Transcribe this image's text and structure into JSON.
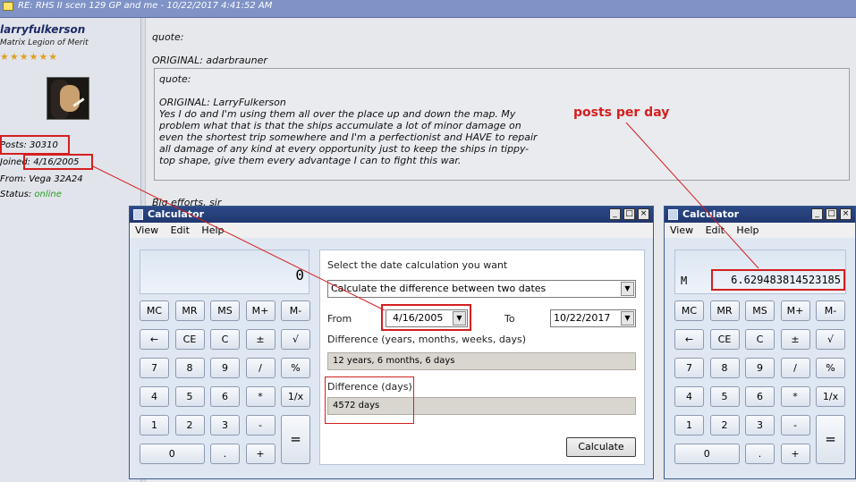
{
  "forum": {
    "post_title": "RE: RHS II scen 129 GP and me - 10/22/2017 4:41:52 AM",
    "username": "larryfulkerson",
    "rank": "Matrix Legion of Merit",
    "stars": "★★★★★★",
    "posts": "Posts: 30310",
    "joined": "Joined: 4/16/2005",
    "from": "From: Vega 32A24",
    "status_label": "Status:",
    "status_value": "online",
    "quote1": "quote:",
    "orig1": "ORIGINAL: adarbrauner",
    "quote2": "quote:",
    "orig2": "ORIGINAL: LarryFulkerson",
    "quote_body": "Yes I do and I'm using them all over the place up and down the map. My problem what that is that the ships accumulate a lot of minor damage on even the shortest trip somewhere and I'm a perfectionist and HAVE to repair all damage of any kind at every opportunity just to keep the ships in tippy-top shape, give them every advantage I can to fight this war.",
    "reply_start": "Big efforts, sir"
  },
  "annotation": {
    "text": "posts per day",
    "color": "#d41f1f"
  },
  "calc_left": {
    "title": "Calculator",
    "menu": [
      "View",
      "Edit",
      "Help"
    ],
    "display": "0",
    "keys": [
      "MC",
      "MR",
      "MS",
      "M+",
      "M-",
      "←",
      "CE",
      "C",
      "±",
      "√",
      "7",
      "8",
      "9",
      "/",
      "%",
      "4",
      "5",
      "6",
      "*",
      "1/x",
      "1",
      "2",
      "3",
      "-",
      "=",
      "0",
      ".",
      "+"
    ],
    "prompt": "Select the date calculation you want",
    "mode": "Calculate the difference between two dates",
    "from_label": "From",
    "from_value": "4/16/2005",
    "to_label": "To",
    "to_value": "10/22/2017",
    "diff_label": "Difference (years, months, weeks, days)",
    "diff_value": "12 years, 6 months, 6 days",
    "days_label": "Difference (days)",
    "days_value": "4572 days",
    "button": "Calculate"
  },
  "calc_right": {
    "title": "Calculator",
    "menu": [
      "View",
      "Edit",
      "Help"
    ],
    "memory_indicator": "M",
    "display": "6.629483814523185",
    "keys": [
      "MC",
      "MR",
      "MS",
      "M+",
      "M-",
      "←",
      "CE",
      "C",
      "±",
      "√",
      "7",
      "8",
      "9",
      "/",
      "%",
      "4",
      "5",
      "6",
      "*",
      "1/x",
      "1",
      "2",
      "3",
      "-",
      "=",
      "0",
      ".",
      "+"
    ]
  },
  "window_buttons": [
    "_",
    "□",
    "×"
  ]
}
